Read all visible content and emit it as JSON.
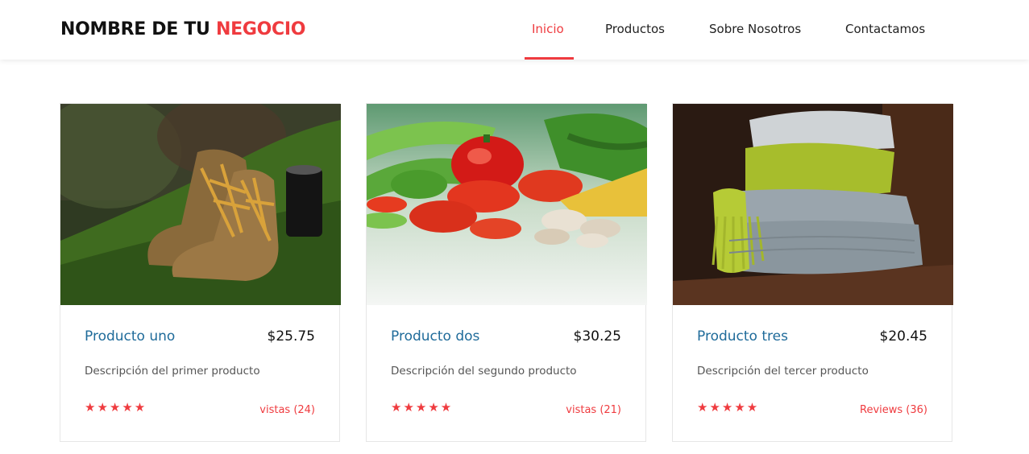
{
  "header": {
    "brand_main": "NOMBRE DE TU ",
    "brand_accent": "NEGOCIO",
    "nav": [
      {
        "label": "Inicio",
        "active": true
      },
      {
        "label": "Productos",
        "active": false
      },
      {
        "label": "Sobre Nosotros",
        "active": false
      },
      {
        "label": "Contactamos",
        "active": false
      }
    ]
  },
  "colors": {
    "accent": "#ef3b3f",
    "title_blue": "#1f6b9a"
  },
  "products": [
    {
      "image_icon": "boots-photo",
      "title": "Producto uno",
      "price": "$25.75",
      "description": "Descripción del primer producto",
      "stars": "★★★★★",
      "reviews": "vistas (24)"
    },
    {
      "image_icon": "vegetables-photo",
      "title": "Producto dos",
      "price": "$30.25",
      "description": "Descripción del segundo producto",
      "stars": "★★★★★",
      "reviews": "vistas (21)"
    },
    {
      "image_icon": "scarves-photo",
      "title": "Producto tres",
      "price": "$20.45",
      "description": "Descripción del tercer producto",
      "stars": "★★★★★",
      "reviews": "Reviews (36)"
    }
  ]
}
